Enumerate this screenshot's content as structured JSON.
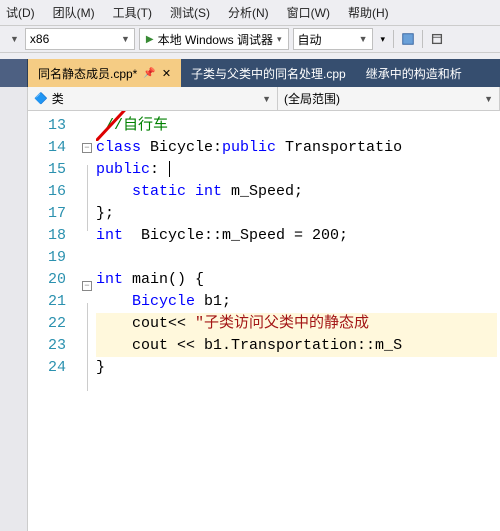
{
  "menu": {
    "items": [
      "试(D)",
      "团队(M)",
      "工具(T)",
      "测试(S)",
      "分析(N)",
      "窗口(W)",
      "帮助(H)"
    ]
  },
  "toolbar": {
    "platform": "x86",
    "debug_label": "本地 Windows 调试器",
    "auto": "自动"
  },
  "tabs": {
    "t0": {
      "label": "同名静态成员.cpp*"
    },
    "t1": {
      "label": "子类与父类中的同名处理.cpp"
    },
    "t2": {
      "label": "继承中的构造和析"
    }
  },
  "scope": {
    "left": "类",
    "right": "(全局范围)"
  },
  "lines": {
    "nums": [
      "13",
      "14",
      "15",
      "16",
      "17",
      "18",
      "19",
      "20",
      "21",
      "22",
      "23",
      "24"
    ]
  },
  "code": {
    "l13": "//自行车",
    "l14a": "class",
    "l14b": " Bicycle:",
    "l14c": "public",
    "l14d": " Transportatio",
    "l15a": "public",
    "l15b": ": ",
    "l16a": "    static int",
    "l16b": " m_Speed;",
    "l17": "};",
    "l18a": "int",
    "l18b": "  Bicycle::m_Speed = 200;",
    "l20a": "int",
    "l20b": " main() {",
    "l21a": "    Bicycle",
    "l21b": " b1;",
    "l22a": "    cout",
    "l22b": "<< ",
    "l22c": "\"子类访问父类中的静态成",
    "l23a": "    cout ",
    "l23b": "<<",
    "l23c": " b1.Transportation::m_S",
    "l24": "}"
  }
}
